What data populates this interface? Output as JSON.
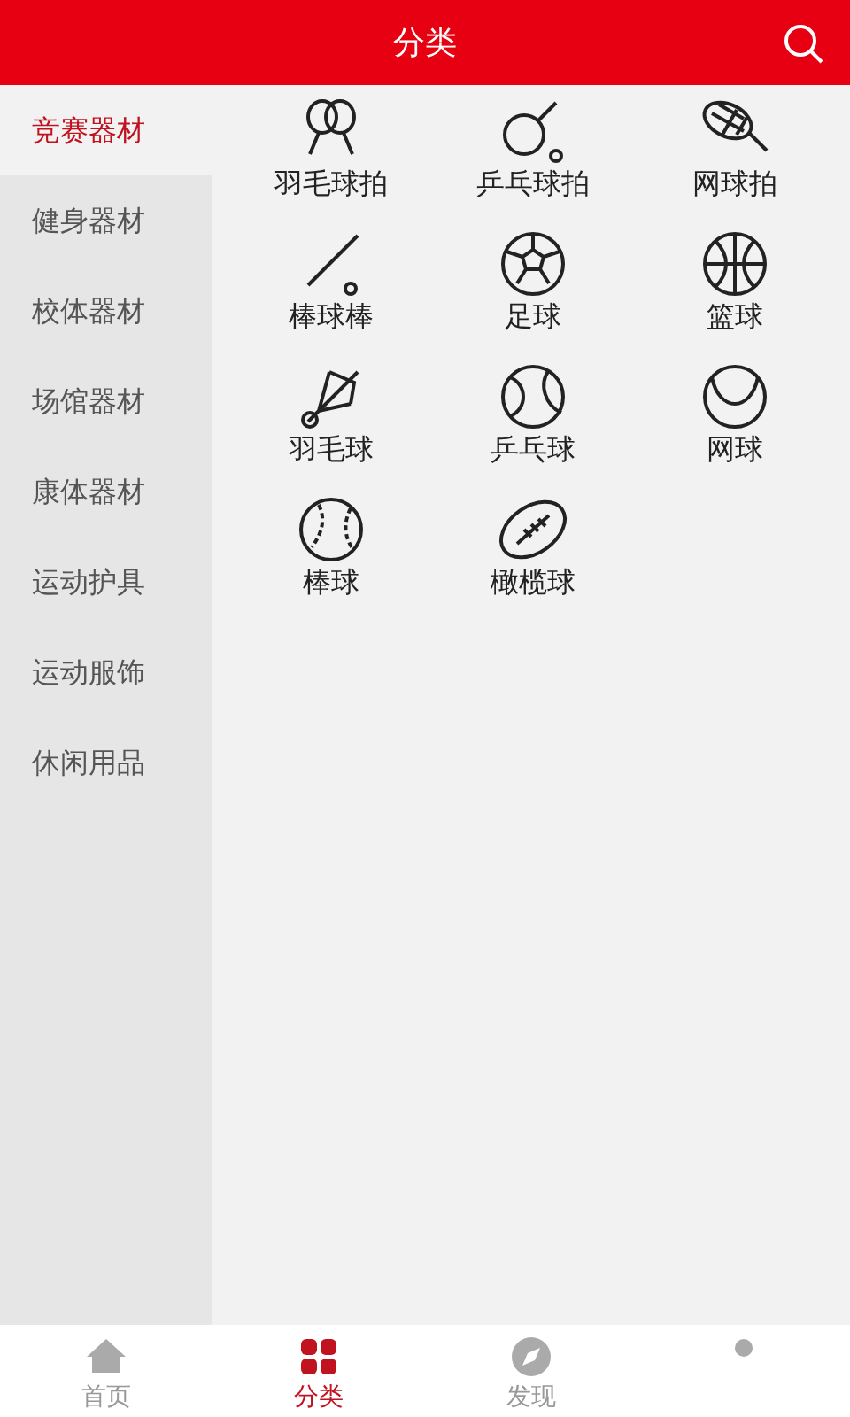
{
  "header": {
    "title": "分类"
  },
  "sidebar": {
    "items": [
      {
        "label": "竞赛器材",
        "selected": true
      },
      {
        "label": "健身器材",
        "selected": false
      },
      {
        "label": "校体器材",
        "selected": false
      },
      {
        "label": "场馆器材",
        "selected": false
      },
      {
        "label": "康体器材",
        "selected": false
      },
      {
        "label": "运动护具",
        "selected": false
      },
      {
        "label": "运动服饰",
        "selected": false
      },
      {
        "label": "休闲用品",
        "selected": false
      }
    ]
  },
  "products": [
    {
      "label": "羽毛球拍"
    },
    {
      "label": "乒乓球拍"
    },
    {
      "label": "网球拍"
    },
    {
      "label": "棒球棒"
    },
    {
      "label": "足球"
    },
    {
      "label": "篮球"
    },
    {
      "label": "羽毛球"
    },
    {
      "label": "乒乓球"
    },
    {
      "label": "网球"
    },
    {
      "label": "棒球"
    },
    {
      "label": "橄榄球"
    }
  ],
  "tab_bar": [
    {
      "label": "首页",
      "selected": false
    },
    {
      "label": "分类",
      "selected": true
    },
    {
      "label": "发现",
      "selected": false
    },
    {
      "selected": false
    }
  ]
}
